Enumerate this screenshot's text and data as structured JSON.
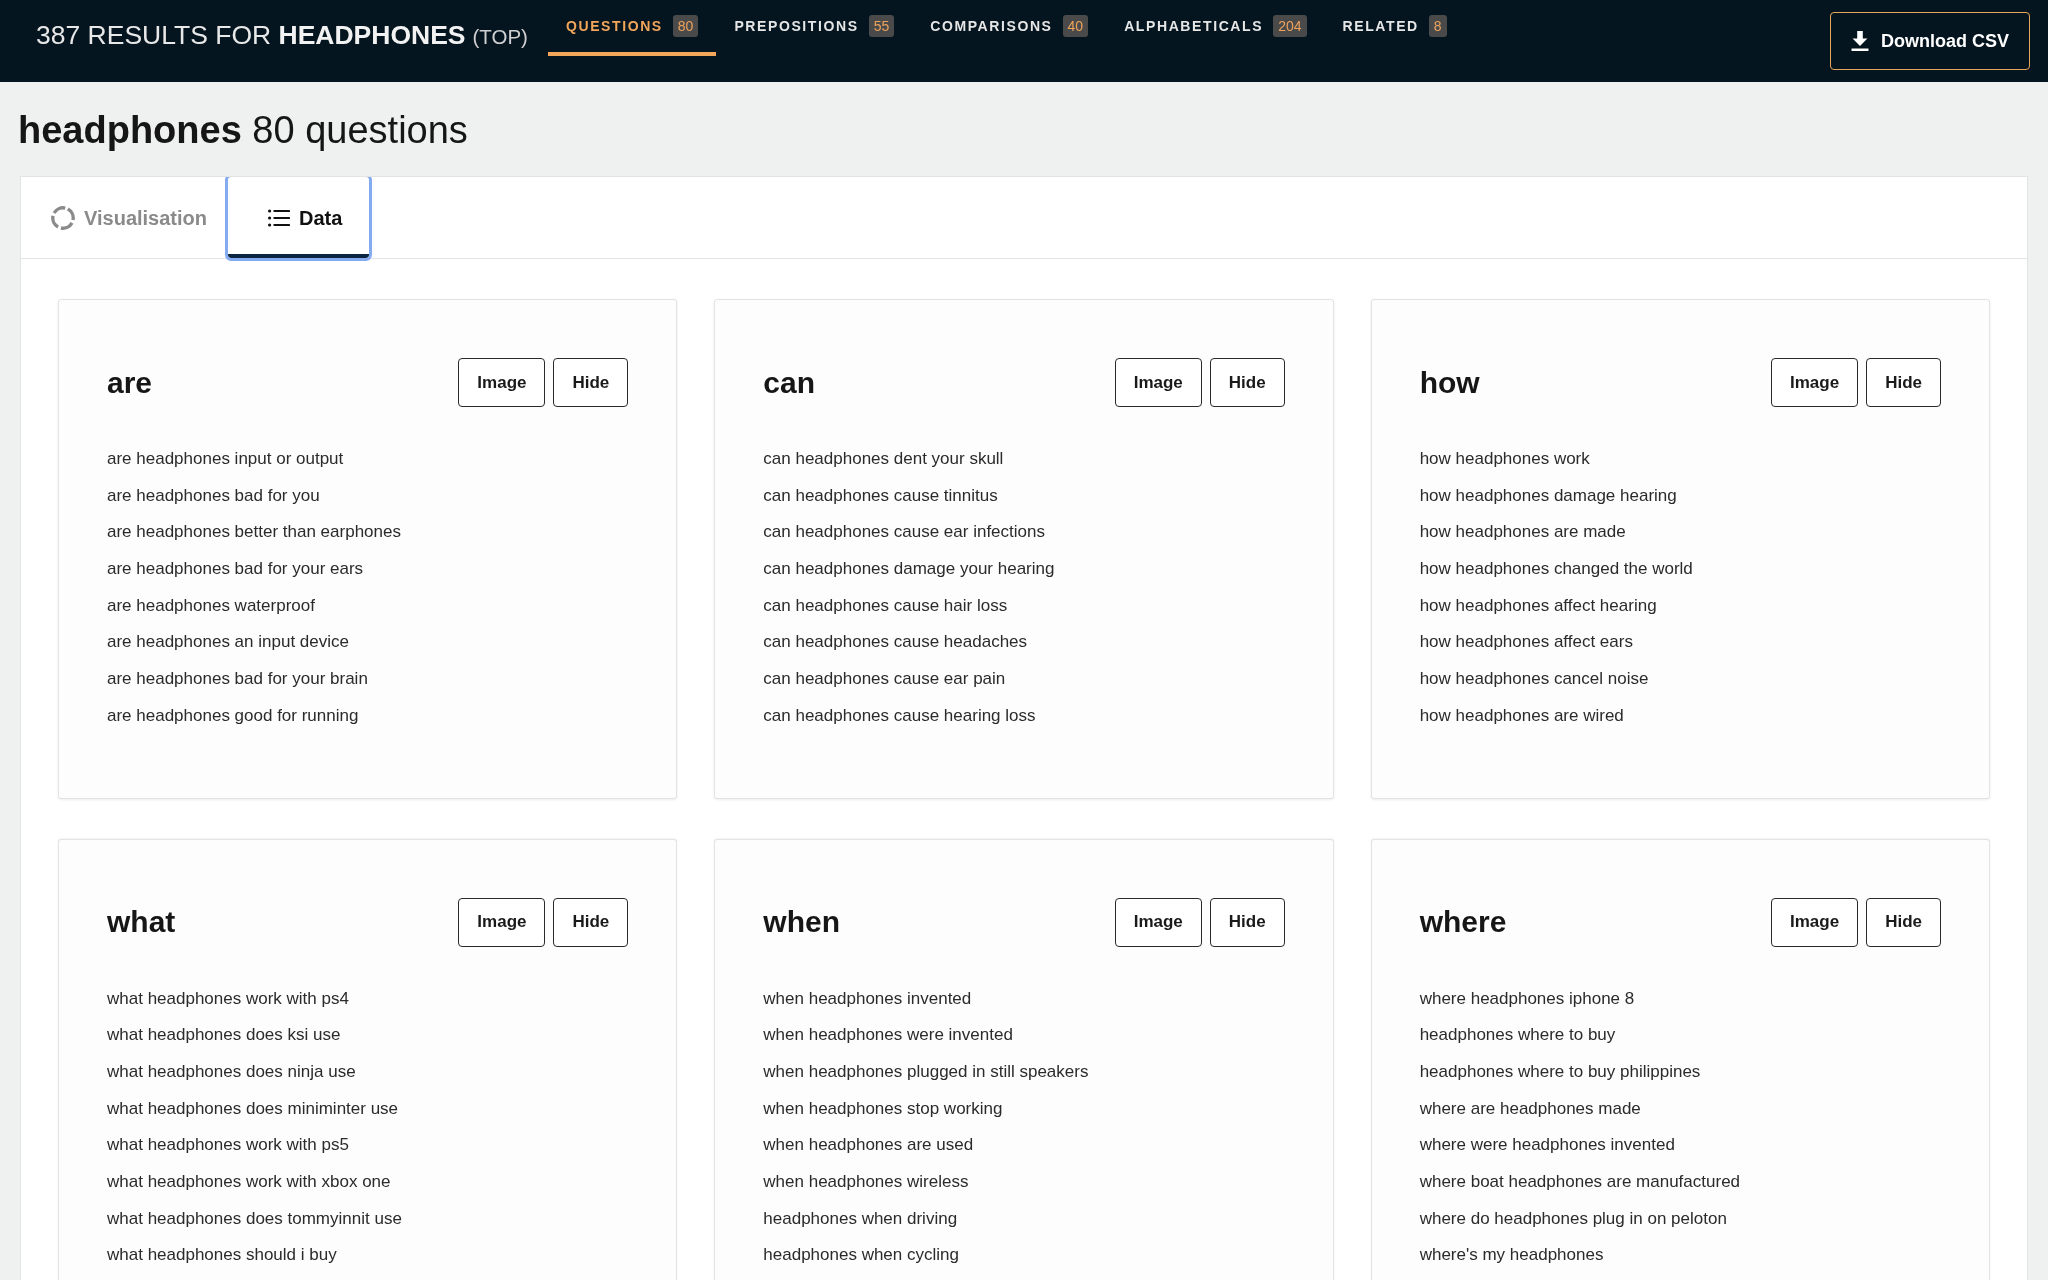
{
  "top_bar": {
    "results_title": "387 RESULTS FOR **HEADPHONES**",
    "sort_label": "(TOP)",
    "tabs": [
      {
        "label": "QUESTIONS",
        "count": "80",
        "selected": true
      },
      {
        "label": "PREPOSITIONS",
        "count": "55",
        "selected": false
      },
      {
        "label": "COMPARISONS",
        "count": "40",
        "selected": false
      },
      {
        "label": "ALPHABETICALS",
        "count": "204",
        "selected": false
      },
      {
        "label": "RELATED",
        "count": "8",
        "selected": false
      }
    ],
    "download_button": {
      "label": "Download CSV"
    }
  },
  "page_heading": "**headphones** 80 questions",
  "view_tabs": [
    {
      "label": "Visualisation",
      "kind": "chart",
      "selected": false,
      "focused": false
    },
    {
      "label": "Data",
      "kind": "list",
      "selected": true,
      "focused": true
    }
  ],
  "groups": [
    {
      "title": "are",
      "buttons": [
        "Image",
        "Hide"
      ],
      "items": [
        "are headphones input or output",
        "are headphones bad for you",
        "are headphones better than earphones",
        "are headphones bad for your ears",
        "are headphones waterproof",
        "are headphones an input device",
        "are headphones bad for your brain",
        "are headphones good for running"
      ]
    },
    {
      "title": "can",
      "buttons": [
        "Image",
        "Hide"
      ],
      "items": [
        "can headphones dent your skull",
        "can headphones cause tinnitus",
        "can headphones cause ear infections",
        "can headphones damage your hearing",
        "can headphones cause hair loss",
        "can headphones cause headaches",
        "can headphones cause ear pain",
        "can headphones cause hearing loss"
      ]
    },
    {
      "title": "how",
      "buttons": [
        "Image",
        "Hide"
      ],
      "items": [
        "how headphones work",
        "how headphones damage hearing",
        "how headphones are made",
        "how headphones changed the world",
        "how headphones affect hearing",
        "how headphones affect ears",
        "how headphones cancel noise",
        "how headphones are wired"
      ]
    },
    {
      "title": "what",
      "buttons": [
        "Image",
        "Hide"
      ],
      "items": [
        "what headphones work with ps4",
        "what headphones does ksi use",
        "what headphones does ninja use",
        "what headphones does miniminter use",
        "what headphones work with ps5",
        "what headphones work with xbox one",
        "what headphones does tommyinnit use",
        "what headphones should i buy"
      ]
    },
    {
      "title": "when",
      "buttons": [
        "Image",
        "Hide"
      ],
      "items": [
        "when headphones invented",
        "when headphones were invented",
        "when headphones plugged in still speakers",
        "when headphones stop working",
        "when headphones are used",
        "when headphones wireless",
        "headphones when driving",
        "headphones when cycling"
      ]
    },
    {
      "title": "where",
      "buttons": [
        "Image",
        "Hide"
      ],
      "items": [
        "where headphones iphone 8",
        "headphones where to buy",
        "headphones where to buy philippines",
        "where are headphones made",
        "where were headphones invented",
        "where boat headphones are manufactured",
        "where do headphones plug in on peloton",
        "where's my headphones"
      ]
    }
  ]
}
